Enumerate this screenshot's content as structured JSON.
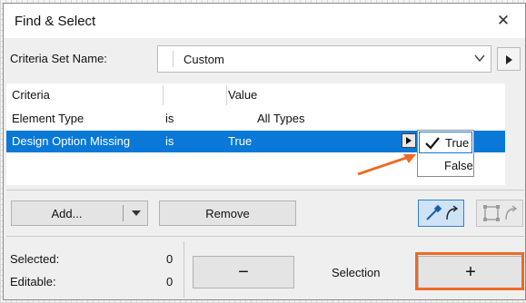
{
  "window": {
    "title": "Find & Select",
    "close_glyph": "✕"
  },
  "criteria_set": {
    "label": "Criteria Set Name:",
    "value": "Custom"
  },
  "table": {
    "headers": {
      "criteria": "Criteria",
      "value": "Value"
    },
    "rows": [
      {
        "criteria": "Element Type",
        "operator": "is",
        "value": "All Types",
        "selected": false
      },
      {
        "criteria": "Design Option Missing",
        "operator": "is",
        "value": "True",
        "selected": true
      }
    ]
  },
  "value_dropdown": {
    "options": [
      "True",
      "False"
    ],
    "checked": "True"
  },
  "buttons": {
    "add": "Add...",
    "remove": "Remove",
    "minus": "−",
    "plus": "+"
  },
  "stats": {
    "selected_label": "Selected:",
    "selected_value": "0",
    "editable_label": "Editable:",
    "editable_value": "0"
  },
  "selection_label": "Selection",
  "colors": {
    "selection_blue": "#0a78d7",
    "annotation_orange": "#ee6a24"
  },
  "icons": [
    "close-icon",
    "chevron-down-icon",
    "play-arrow-icon",
    "checkmark-icon",
    "eyedropper-icon",
    "marquee-select-icon",
    "turn-arrow-icon"
  ]
}
